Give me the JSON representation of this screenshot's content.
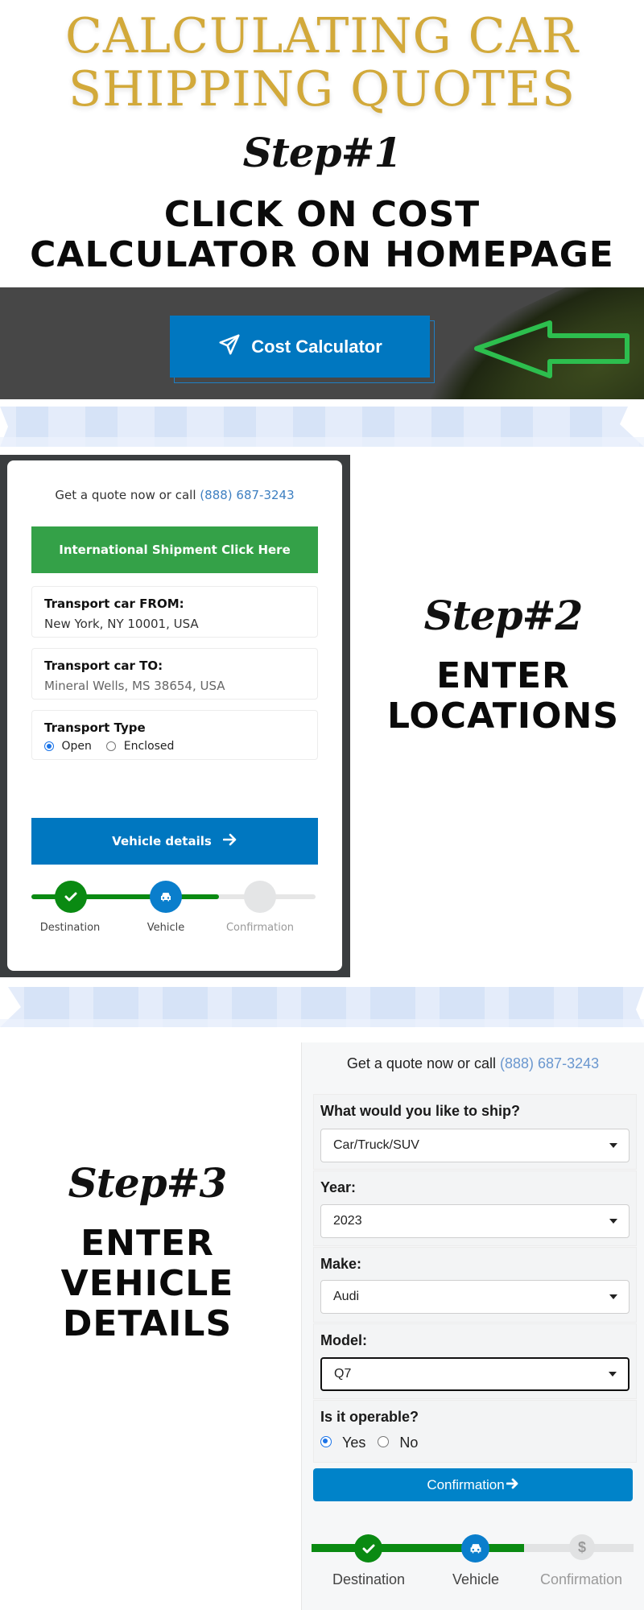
{
  "header": {
    "title_line1": "CALCULATING CAR",
    "title_line2": "SHIPPING QUOTES"
  },
  "step1": {
    "step_label": "Step#1",
    "heading_line1": "CLICK ON COST",
    "heading_line2": "CALCULATOR ON HOMEPAGE",
    "button_label": "Cost Calculator",
    "button_icon": "paper-plane-icon",
    "pointer_icon": "arrow-left-outline-icon",
    "colors": {
      "button": "#0077C0",
      "arrow": "#2DBE4E",
      "title": "#D2A93A"
    }
  },
  "step2": {
    "step_label": "Step#2",
    "heading_line1": "ENTER",
    "heading_line2": "LOCATIONS",
    "form": {
      "quote_text": "Get a quote now or call",
      "phone": "(888) 687-3243",
      "intl_button": "International Shipment Click Here",
      "from_label": "Transport car FROM:",
      "from_value": "New York, NY 10001, USA",
      "to_label": "Transport car TO:",
      "to_value": "Mineral Wells, MS 38654, USA",
      "type_label": "Transport Type",
      "type_options": [
        {
          "label": "Open",
          "checked": true
        },
        {
          "label": "Enclosed",
          "checked": false
        }
      ],
      "next_button": "Vehicle details",
      "next_icon": "arrow-right-icon"
    },
    "progress": {
      "completed_fraction": 0.66,
      "steps": [
        {
          "label": "Destination",
          "state": "done",
          "icon": "check-icon"
        },
        {
          "label": "Vehicle",
          "state": "active",
          "icon": "car-icon"
        },
        {
          "label": "Confirmation",
          "state": "pending",
          "icon": ""
        }
      ]
    }
  },
  "step3": {
    "step_label": "Step#3",
    "heading_line1": "ENTER",
    "heading_line2": "VEHICLE",
    "heading_line3": "DETAILS",
    "form": {
      "quote_text": "Get a quote now or call",
      "phone": "(888) 687-3243",
      "fields": [
        {
          "label": "What would you like to ship?",
          "value": "Car/Truck/SUV"
        },
        {
          "label": "Year:",
          "value": "2023"
        },
        {
          "label": "Make:",
          "value": "Audi"
        },
        {
          "label": "Model:",
          "value": "Q7"
        }
      ],
      "operable_label": "Is it operable?",
      "operable_options": [
        {
          "label": "Yes",
          "checked": true
        },
        {
          "label": "No",
          "checked": false
        }
      ],
      "next_button": "Confirmation",
      "next_icon": "arrow-right-icon"
    },
    "progress": {
      "completed_fraction": 0.66,
      "steps": [
        {
          "label": "Destination",
          "state": "done",
          "icon": "check-icon"
        },
        {
          "label": "Vehicle",
          "state": "active",
          "icon": "car-icon"
        },
        {
          "label": "Confirmation",
          "state": "pending",
          "icon": "dollar-icon"
        }
      ]
    }
  }
}
